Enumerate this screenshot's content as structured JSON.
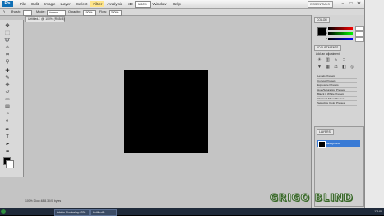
{
  "app": {
    "logo": "Ps",
    "window_controls": [
      "–",
      "□",
      "✕"
    ]
  },
  "menu": {
    "items": [
      "File",
      "Edit",
      "Image",
      "Layer",
      "Select",
      "Filter",
      "Analysis",
      "3D",
      "View",
      "Window",
      "Help"
    ],
    "selected_index": 5,
    "zoom": "100%",
    "workspace": "ESSENTIALS"
  },
  "options": {
    "brush_label": "Brush:",
    "mode_label": "Mode:",
    "mode_value": "Normal",
    "opacity_label": "Opacity:",
    "opacity_value": "100%",
    "flow_label": "Flow:",
    "flow_value": "100%"
  },
  "document": {
    "tab_label": "Untitled-1 @ 100% (RGB/8)",
    "status": "100%   Doc: 488.3K/0 bytes"
  },
  "panels": {
    "color_tab": "COLOR",
    "adjustments_tab": "ADJUSTMENTS",
    "adjust_header": "Add an adjustment",
    "channels": [
      "R",
      "G",
      "B"
    ],
    "presets": [
      "Levels Presets",
      "Curves Presets",
      "Exposure Presets",
      "Hue/Saturation Presets",
      "Black & White Presets",
      "Channel Mixer Presets",
      "Selective Color Presets"
    ],
    "layers_tab": "LAYERS",
    "layer_name": "Background"
  },
  "taskbar": {
    "items": [
      "Adobe Photoshop CS4",
      "Untitled-1"
    ],
    "clock": "12:00"
  },
  "watermark": "GRIGO BLIND",
  "colors": {
    "accent": "#3a7bd5",
    "canvas": "#000000",
    "workspace_bg": "#c4c4c4"
  }
}
